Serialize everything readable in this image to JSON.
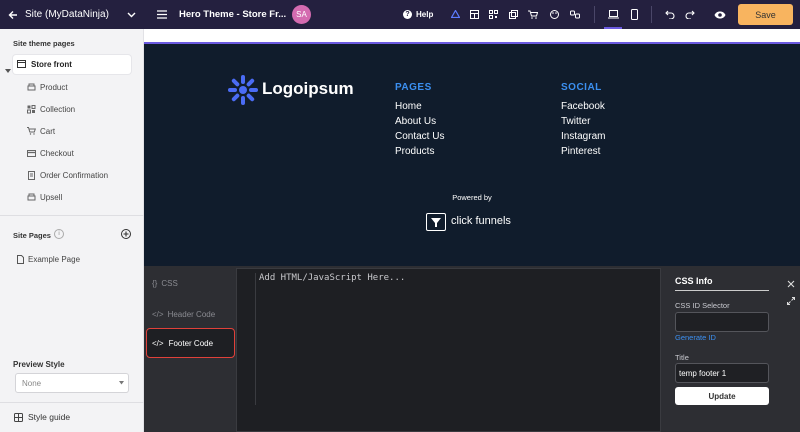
{
  "topbar": {
    "site_label": "Site (MyDataNinja)",
    "theme_label": "Hero Theme - Store Fr...",
    "avatar_initials": "SA",
    "help_label": "Help",
    "save_label": "Save",
    "colors": {
      "bg": "#24203f",
      "save": "#f8b45f",
      "avatar": "#d46bb0"
    }
  },
  "sidebar": {
    "theme_pages_heading": "Site theme pages",
    "store_front": "Store front",
    "pages": [
      "Product",
      "Collection",
      "Cart",
      "Checkout",
      "Order Confirmation",
      "Upsell"
    ],
    "site_pages_heading": "Site Pages",
    "site_pages": [
      "Example Page"
    ],
    "preview_style_label": "Preview Style",
    "preview_style_value": "None",
    "style_guide": "Style guide"
  },
  "footer_preview": {
    "logo_text": "Logoipsum",
    "pages_heading": "PAGES",
    "pages_links": [
      "Home",
      "About Us",
      "Contact Us",
      "Products"
    ],
    "social_heading": "SOCIAL",
    "social_links": [
      "Facebook",
      "Twitter",
      "Instagram",
      "Pinterest"
    ],
    "powered_by": "Powered by",
    "brand": "click funnels"
  },
  "code_panel": {
    "tabs": [
      "CSS",
      "Header Code",
      "Footer Code"
    ],
    "active_tab": "Footer Code",
    "editor_placeholder": "Add HTML/JavaScript Here..."
  },
  "css_info": {
    "title": "CSS Info",
    "id_selector_label": "CSS ID Selector",
    "id_selector_value": "",
    "generate_id": "Generate ID",
    "title_label": "Title",
    "title_value": "temp footer 1",
    "update_label": "Update"
  }
}
